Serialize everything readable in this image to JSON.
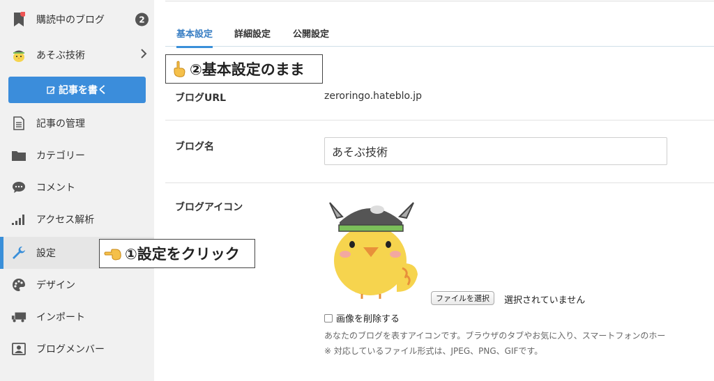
{
  "sidebar": {
    "reading": {
      "label": "購読中のブログ",
      "count": "2"
    },
    "blog": {
      "label": "あそぶ技術"
    },
    "write_button": "記事を書く",
    "items": [
      {
        "label": "記事の管理",
        "icon": "document-icon"
      },
      {
        "label": "カテゴリー",
        "icon": "folder-icon"
      },
      {
        "label": "コメント",
        "icon": "comment-icon"
      },
      {
        "label": "アクセス解析",
        "icon": "signal-bars-icon"
      },
      {
        "label": "設定",
        "icon": "wrench-icon",
        "active": true
      },
      {
        "label": "デザイン",
        "icon": "palette-icon"
      },
      {
        "label": "インポート",
        "icon": "truck-icon"
      },
      {
        "label": "ブログメンバー",
        "icon": "members-icon"
      }
    ]
  },
  "tabs": [
    {
      "label": "基本設定",
      "active": true
    },
    {
      "label": "詳細設定"
    },
    {
      "label": "公開設定"
    }
  ],
  "settings": {
    "url_label": "ブログURL",
    "url_value": "zeroringo.hateblo.jp",
    "name_label": "ブログ名",
    "name_value": "あそぶ技術",
    "icon_label": "ブログアイコン",
    "file_button": "ファイルを選択",
    "file_status": "選択されていません",
    "delete_label": "画像を削除する",
    "help_line1": "あなたのブログを表すアイコンです。ブラウザのタブやお気に入り、スマートフォンのホー",
    "help_line2": "※ 対応しているファイル形式は、JPEG、PNG、GIFです。"
  },
  "annotations": {
    "step1": "①設定をクリック",
    "step2": "②基本設定のまま"
  },
  "colors": {
    "accent": "#3a8fd9",
    "button": "#3b8ddb",
    "sidebar_bg": "#f1f1f1"
  }
}
